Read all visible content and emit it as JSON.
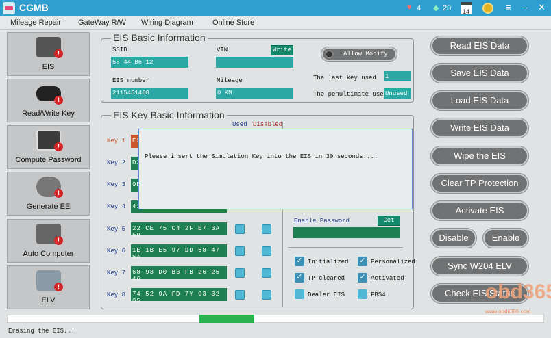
{
  "app": {
    "title": "CGMB",
    "notifications": "4",
    "gems": "20",
    "calendar_day": "14"
  },
  "menu": [
    "Mileage Repair",
    "GateWay R/W",
    "Wiring Diagram",
    "Online Store"
  ],
  "sidebar": [
    {
      "label": "EIS",
      "icon": "eis-unit-icon"
    },
    {
      "label": "Read/Write Key",
      "icon": "car-key-icon"
    },
    {
      "label": "Compute Password",
      "icon": "computer-icon"
    },
    {
      "label": "Generate EE",
      "icon": "chip-programmer-icon"
    },
    {
      "label": "Auto Computer",
      "icon": "ecu-icon"
    },
    {
      "label": "ELV",
      "icon": "steering-lock-icon"
    }
  ],
  "basic_info": {
    "title": "EIS Basic Information",
    "ssid_label": "SSID",
    "ssid_value": "58 44 B6 12",
    "vin_label": "VIN",
    "vin_value": "",
    "write_label": "Write",
    "eis_number_label": "EIS number",
    "eis_number_value": "2115451408",
    "mileage_label": "Mileage",
    "mileage_value": "0 KM",
    "allow_modify_label": "Allow Modify",
    "last_key_label": "The last key used",
    "last_key_value": "1",
    "penultimate_label": "The penultimate used",
    "penultimate_value": "Unused"
  },
  "key_info": {
    "title": "EIS Key Basic Information",
    "used_label": "Used",
    "disabled_label": "Disabled",
    "keys": [
      {
        "label": "Key 1",
        "value": "E3"
      },
      {
        "label": "Key 2",
        "value": "D3"
      },
      {
        "label": "Key 3",
        "value": "0B"
      },
      {
        "label": "Key 4",
        "value": "41"
      },
      {
        "label": "Key 5",
        "value": "22 CE 75 C4 2F E7 3A 59"
      },
      {
        "label": "Key 6",
        "value": "1E 1B E5 97 DD 68 47 6A"
      },
      {
        "label": "Key 7",
        "value": "68 98 D0 B3 FB 26 25 46"
      },
      {
        "label": "Key 8",
        "value": "74 52 9A FD 7Y 93 32 05"
      }
    ],
    "enable_password_label": "Enable Password",
    "enable_password_value": "",
    "get_label": "Get",
    "checks": [
      {
        "label": "Initialized",
        "checked": true
      },
      {
        "label": "Personalized",
        "checked": true
      },
      {
        "label": "TP cleared",
        "checked": true
      },
      {
        "label": "Activated",
        "checked": true
      },
      {
        "label": "Dealer EIS",
        "checked": false
      },
      {
        "label": "FBS4",
        "checked": false
      }
    ]
  },
  "actions": [
    "Read  EIS Data",
    "Save EIS Data",
    "Load EIS Data",
    "Write EIS Data",
    "Wipe the EIS",
    "Clear TP Protection",
    "Activate EIS",
    "Disable",
    "Enable",
    "Sync W204 ELV",
    "Check EIS Status"
  ],
  "dialog": {
    "message": "Please insert the Simulation Key into the EIS in 30 seconds...."
  },
  "progress": {
    "fraction": 0.102
  },
  "status": "Erasing  the  EIS...",
  "watermark": {
    "text": "obd365",
    "url": "www.obdii365.com"
  },
  "colors": {
    "titlebar": "#2f9fd2",
    "field": "#2ba8a4",
    "key_field": "#1d7f52",
    "button": "#707273",
    "progress": "#2bb34f",
    "key_highlight": "#c8562a"
  }
}
